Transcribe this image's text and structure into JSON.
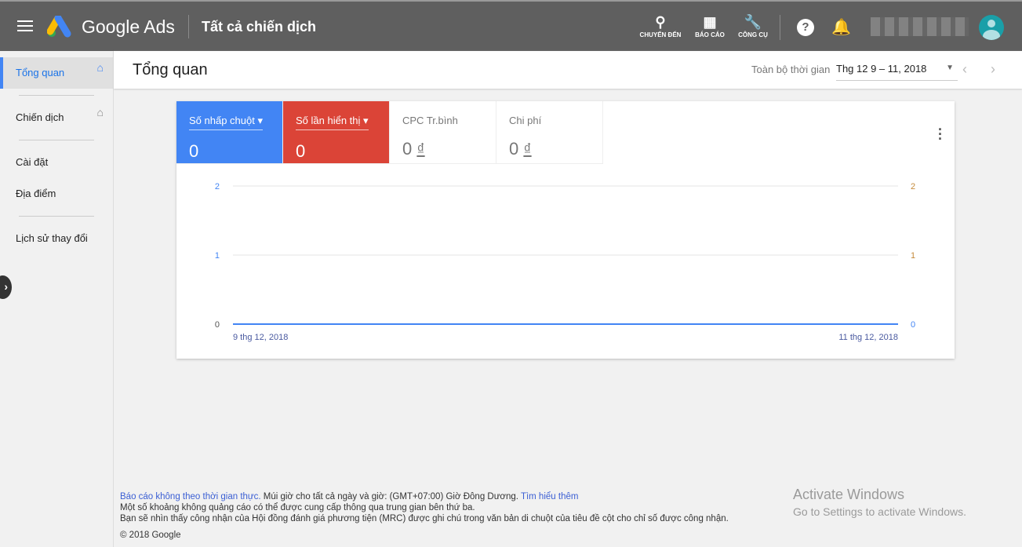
{
  "header": {
    "brand": "Google Ads",
    "page_title": "Tất cả chiến dịch",
    "tools": [
      {
        "label": "CHUYỂN ĐẾN",
        "icon": "search-icon"
      },
      {
        "label": "BÁO CÁO",
        "icon": "report-icon"
      },
      {
        "label": "CÔNG CỤ",
        "icon": "wrench-icon"
      }
    ]
  },
  "sidebar": {
    "items": [
      {
        "label": "Tổng quan",
        "active": true
      },
      {
        "label": "Chiến dịch"
      },
      {
        "label": "Cài đặt"
      },
      {
        "label": "Địa điểm"
      },
      {
        "label": "Lịch sử thay đổi"
      }
    ]
  },
  "overview": {
    "title": "Tổng quan",
    "range_label": "Toàn bộ thời gian",
    "date_range": "Thg 12 9 – 11, 2018"
  },
  "metrics": [
    {
      "label": "Số nhấp chuột",
      "value": "0",
      "color": "#4285f4"
    },
    {
      "label": "Số lần hiển thị",
      "value": "0",
      "color": "#db4437"
    },
    {
      "label": "CPC Tr.bình",
      "value": "0",
      "currency": "₫"
    },
    {
      "label": "Chi phí",
      "value": "0",
      "currency": "₫"
    }
  ],
  "chart_data": {
    "type": "line",
    "x": [
      "9 thg 12, 2018",
      "11 thg 12, 2018"
    ],
    "series": [
      {
        "name": "Số nhấp chuột",
        "values": [
          0,
          0
        ],
        "color": "#4285f4"
      },
      {
        "name": "Số lần hiển thị",
        "values": [
          0,
          0
        ],
        "color": "#db4437"
      }
    ],
    "ylim": [
      0,
      2
    ],
    "yticks_left": [
      "0",
      "1",
      "2"
    ],
    "yticks_right": [
      "0",
      "1",
      "2"
    ],
    "grid": true
  },
  "footer": {
    "link1": "Báo cáo không theo thời gian thực.",
    "text1": " Múi giờ cho tất cả ngày và giờ: (GMT+07:00) Giờ Đông Dương. ",
    "link2": "Tìm hiểu thêm",
    "line2": "Một số khoảng không quảng cáo có thể được cung cấp thông qua trung gian bên thứ ba.",
    "line3": "Bạn sẽ nhìn thấy công nhận của Hội đồng đánh giá phương tiện (MRC) được ghi chú trong văn bản di chuột của tiêu đề cột cho chỉ số được công nhận.",
    "copyright": "© 2018 Google"
  },
  "watermark": {
    "title": "Activate Windows",
    "subtitle": "Go to Settings to activate Windows."
  }
}
